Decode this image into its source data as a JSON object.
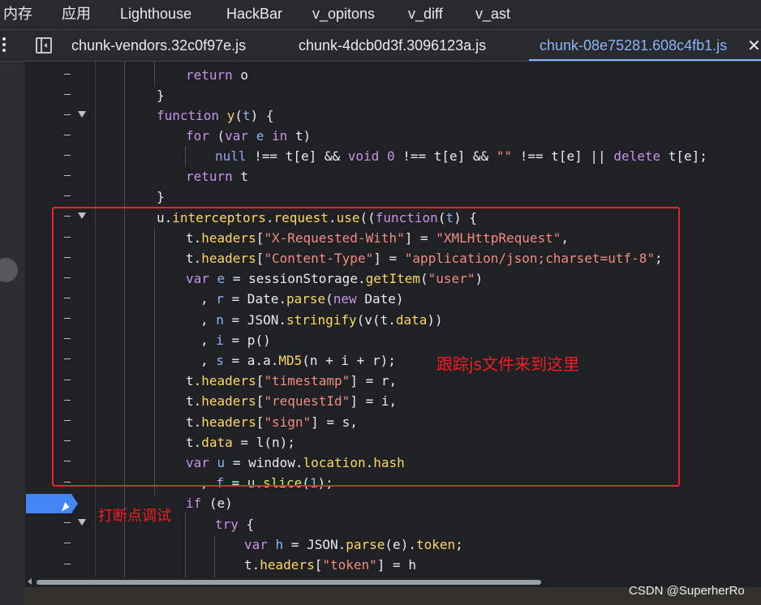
{
  "panel_tabs": [
    "内存",
    "应用",
    "Lighthouse",
    "HackBar",
    "v_opitons",
    "v_diff",
    "v_ast"
  ],
  "file_tabs": [
    {
      "label": "chunk-vendors.32c0f97e.js",
      "active": false
    },
    {
      "label": "chunk-4dcb0d3f.3096123a.js",
      "active": false
    },
    {
      "label": "chunk-08e75281.608c4fb1.js",
      "active": true
    }
  ],
  "annotations": {
    "trace": "跟踪js文件来到这里",
    "breakpoint": "打断点调试"
  },
  "watermark": "CSDN @SuperherRo",
  "icons": [
    "more-vert-icon",
    "toggle-navigator-icon",
    "close-icon",
    "fold-arrow-icon",
    "breakpoint-marker-icon",
    "mouse-cursor-icon"
  ],
  "colors": {
    "highlight_box": "#e8242a",
    "annotation_text": "#f01e23",
    "active_tab": "#8ab4f8",
    "breakpoint": "#4285f4"
  },
  "code_lines": [
    "return o",
    "}",
    "function y(t) {",
    "for (var e in t)",
    "null !== t[e] && void 0 !== t[e] && \"\" !== t[e] || delete t[e];",
    "return t",
    "}",
    "u.interceptors.request.use((function(t) {",
    "t.headers[\"X-Requested-With\"] = \"XMLHttpRequest\",",
    "t.headers[\"Content-Type\"] = \"application/json;charset=utf-8\";",
    "var e = sessionStorage.getItem(\"user\")",
    ", r = Date.parse(new Date)",
    ", n = JSON.stringify(v(t.data))",
    ", i = p()",
    ", s = a.a.MD5(n + i + r);",
    "t.headers[\"timestamp\"] = r,",
    "t.headers[\"requestId\"] = i,",
    "t.headers[\"sign\"] = s,",
    "t.data = l(n);",
    "var u = window.location.hash",
    ", f = u.slice(1);",
    "if (e)",
    "try {",
    "var h = JSON.parse(e).token;",
    "t.headers[\"token\"] = h"
  ]
}
